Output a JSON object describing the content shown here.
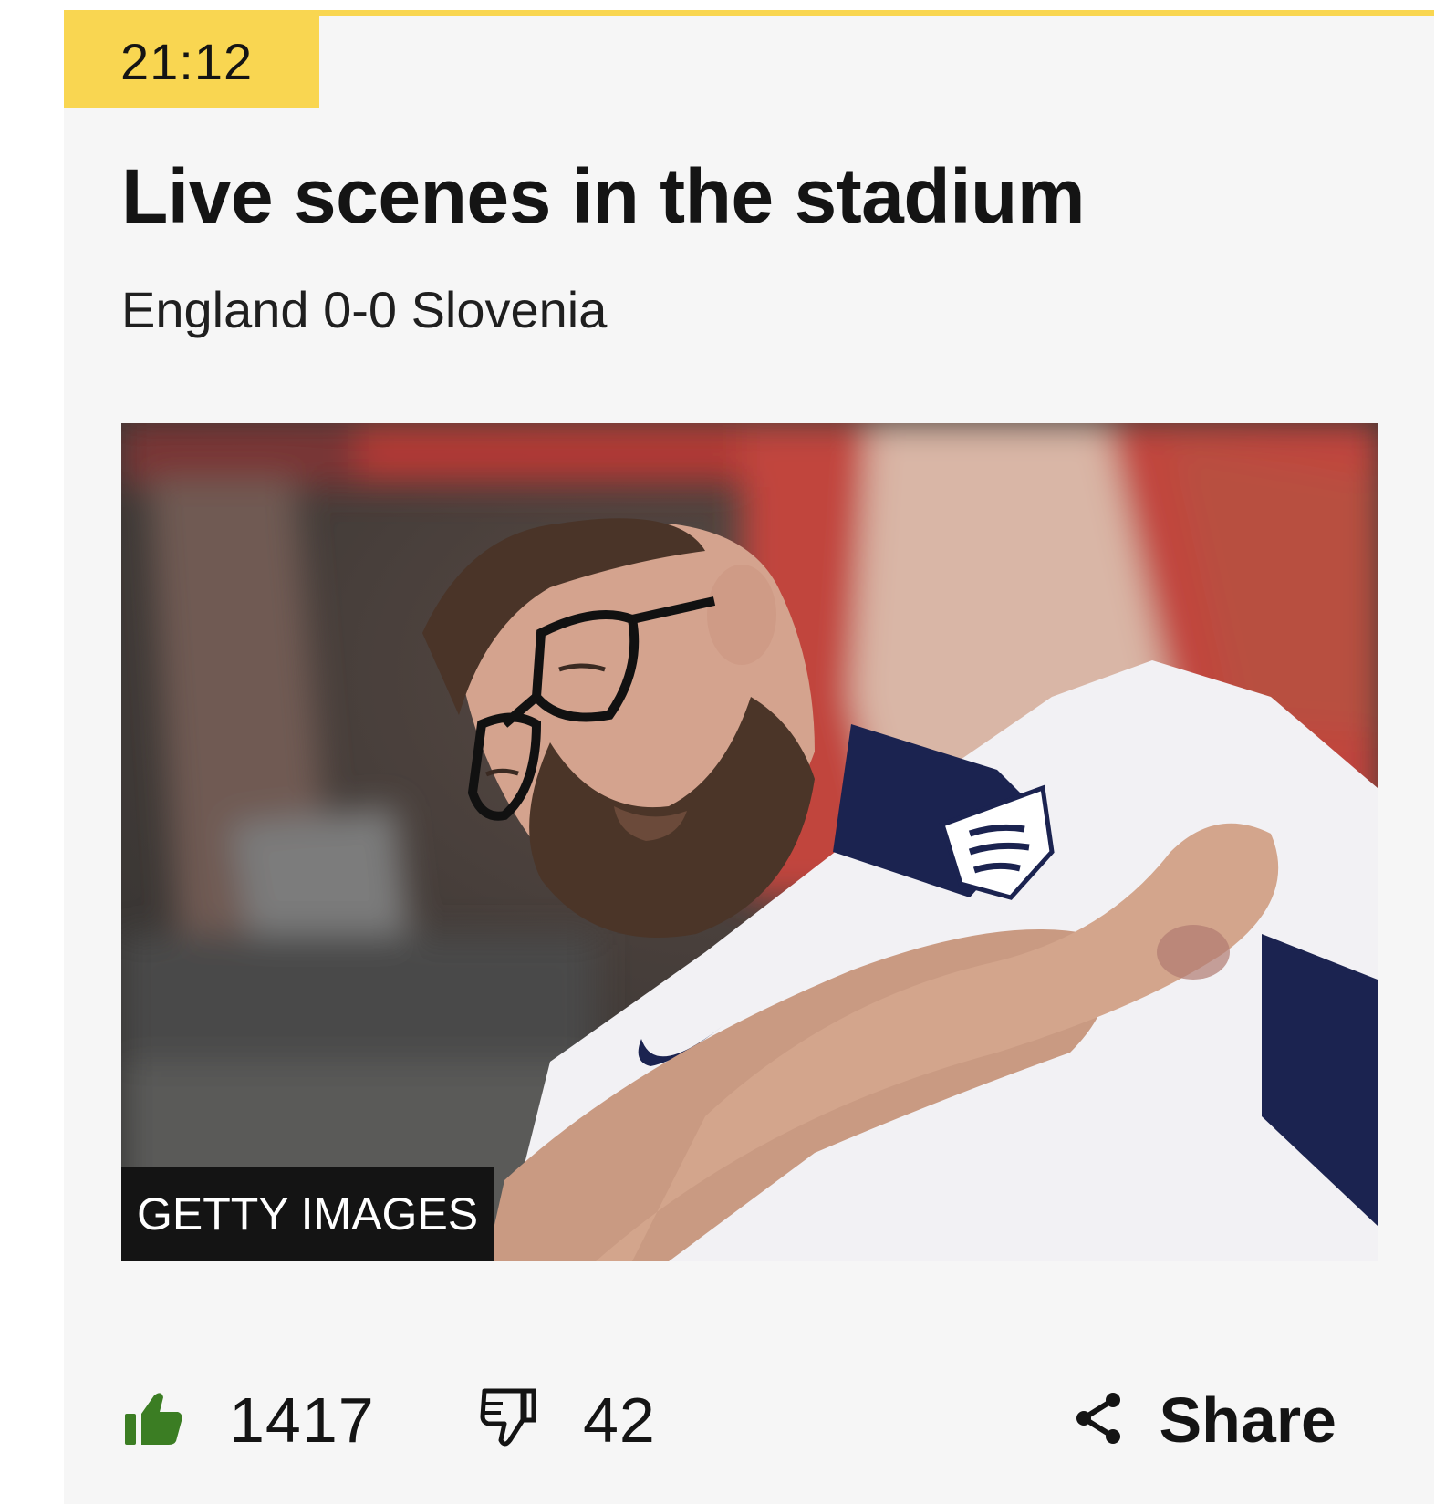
{
  "post": {
    "timestamp": "21:12",
    "headline": "Live scenes in the stadium",
    "subheadline": "England 0-0 Slovenia"
  },
  "image": {
    "credit": "GETTY IMAGES"
  },
  "reactions": {
    "likes": "1417",
    "dislikes": "42",
    "share_label": "Share"
  },
  "icons": {
    "like": "thumbs-up-icon",
    "dislike": "thumbs-down-icon",
    "share": "share-icon"
  },
  "colors": {
    "accent": "#f9d651",
    "like_green": "#3b7d23",
    "text": "#141414",
    "card_background": "#f6f6f6"
  }
}
